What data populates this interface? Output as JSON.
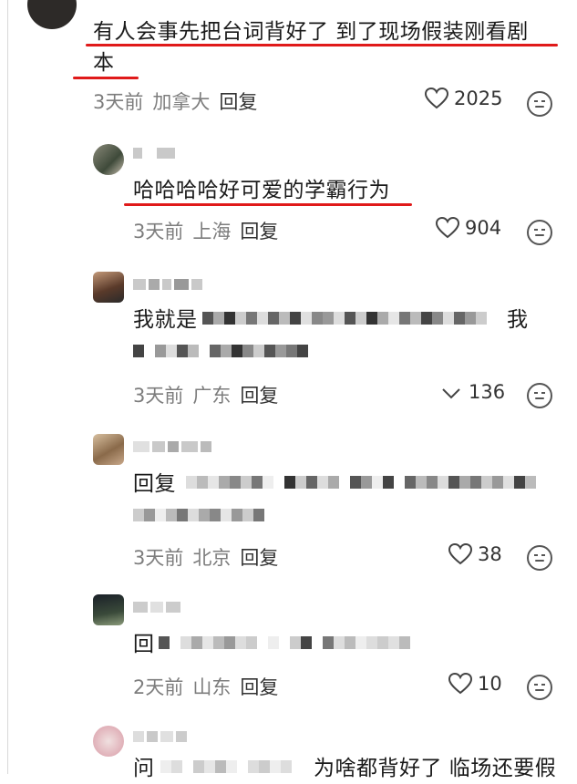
{
  "comments": [
    {
      "text_line1": "有人会事先把台词背好了 到了现场假装刚看剧",
      "text_line2": "本",
      "time": "3天前",
      "location": "加拿大",
      "reply_label": "回复",
      "likes": "2025"
    },
    {
      "text": "哈哈哈哈好可爱的学霸行为",
      "time": "3天前",
      "location": "上海",
      "reply_label": "回复",
      "likes": "904"
    },
    {
      "text_start": "我就是",
      "text_end": "我",
      "time": "3天前",
      "location": "广东",
      "reply_label": "回复",
      "likes": "136"
    },
    {
      "text_start": "回复",
      "time": "3天前",
      "location": "北京",
      "reply_label": "回复",
      "likes": "38"
    },
    {
      "text_start": "回",
      "time": "2天前",
      "location": "山东",
      "reply_label": "回复",
      "likes": "10"
    },
    {
      "text_start": "问",
      "text_end": "为啥都背好了 临场还要假"
    }
  ],
  "colors": {
    "highlight": "#e01a1a",
    "meta": "#7d7d7d"
  },
  "icons": {
    "like": "heart-icon",
    "emoji": "emoji-face-icon"
  }
}
